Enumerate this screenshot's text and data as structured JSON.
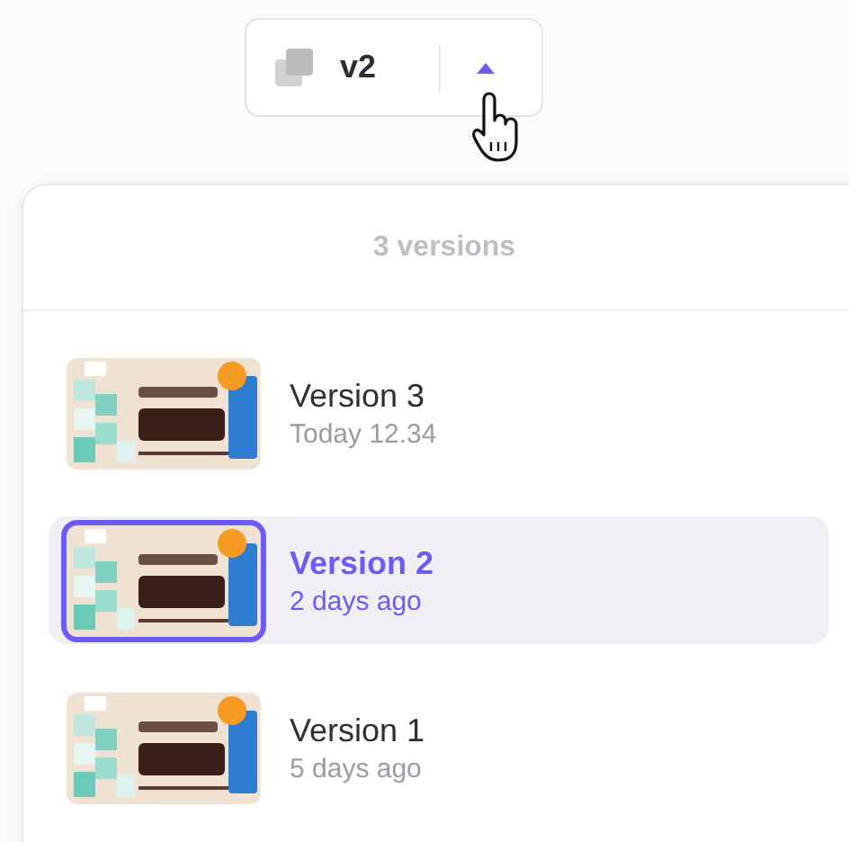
{
  "version_button": {
    "label": "v2",
    "expanded": true
  },
  "panel": {
    "heading": "3 versions"
  },
  "versions": [
    {
      "title": "Version 3",
      "time": "Today 12.34",
      "selected": false
    },
    {
      "title": "Version 2",
      "time": "2 days ago",
      "selected": true
    },
    {
      "title": "Version 1",
      "time": "5 days ago",
      "selected": false
    }
  ]
}
